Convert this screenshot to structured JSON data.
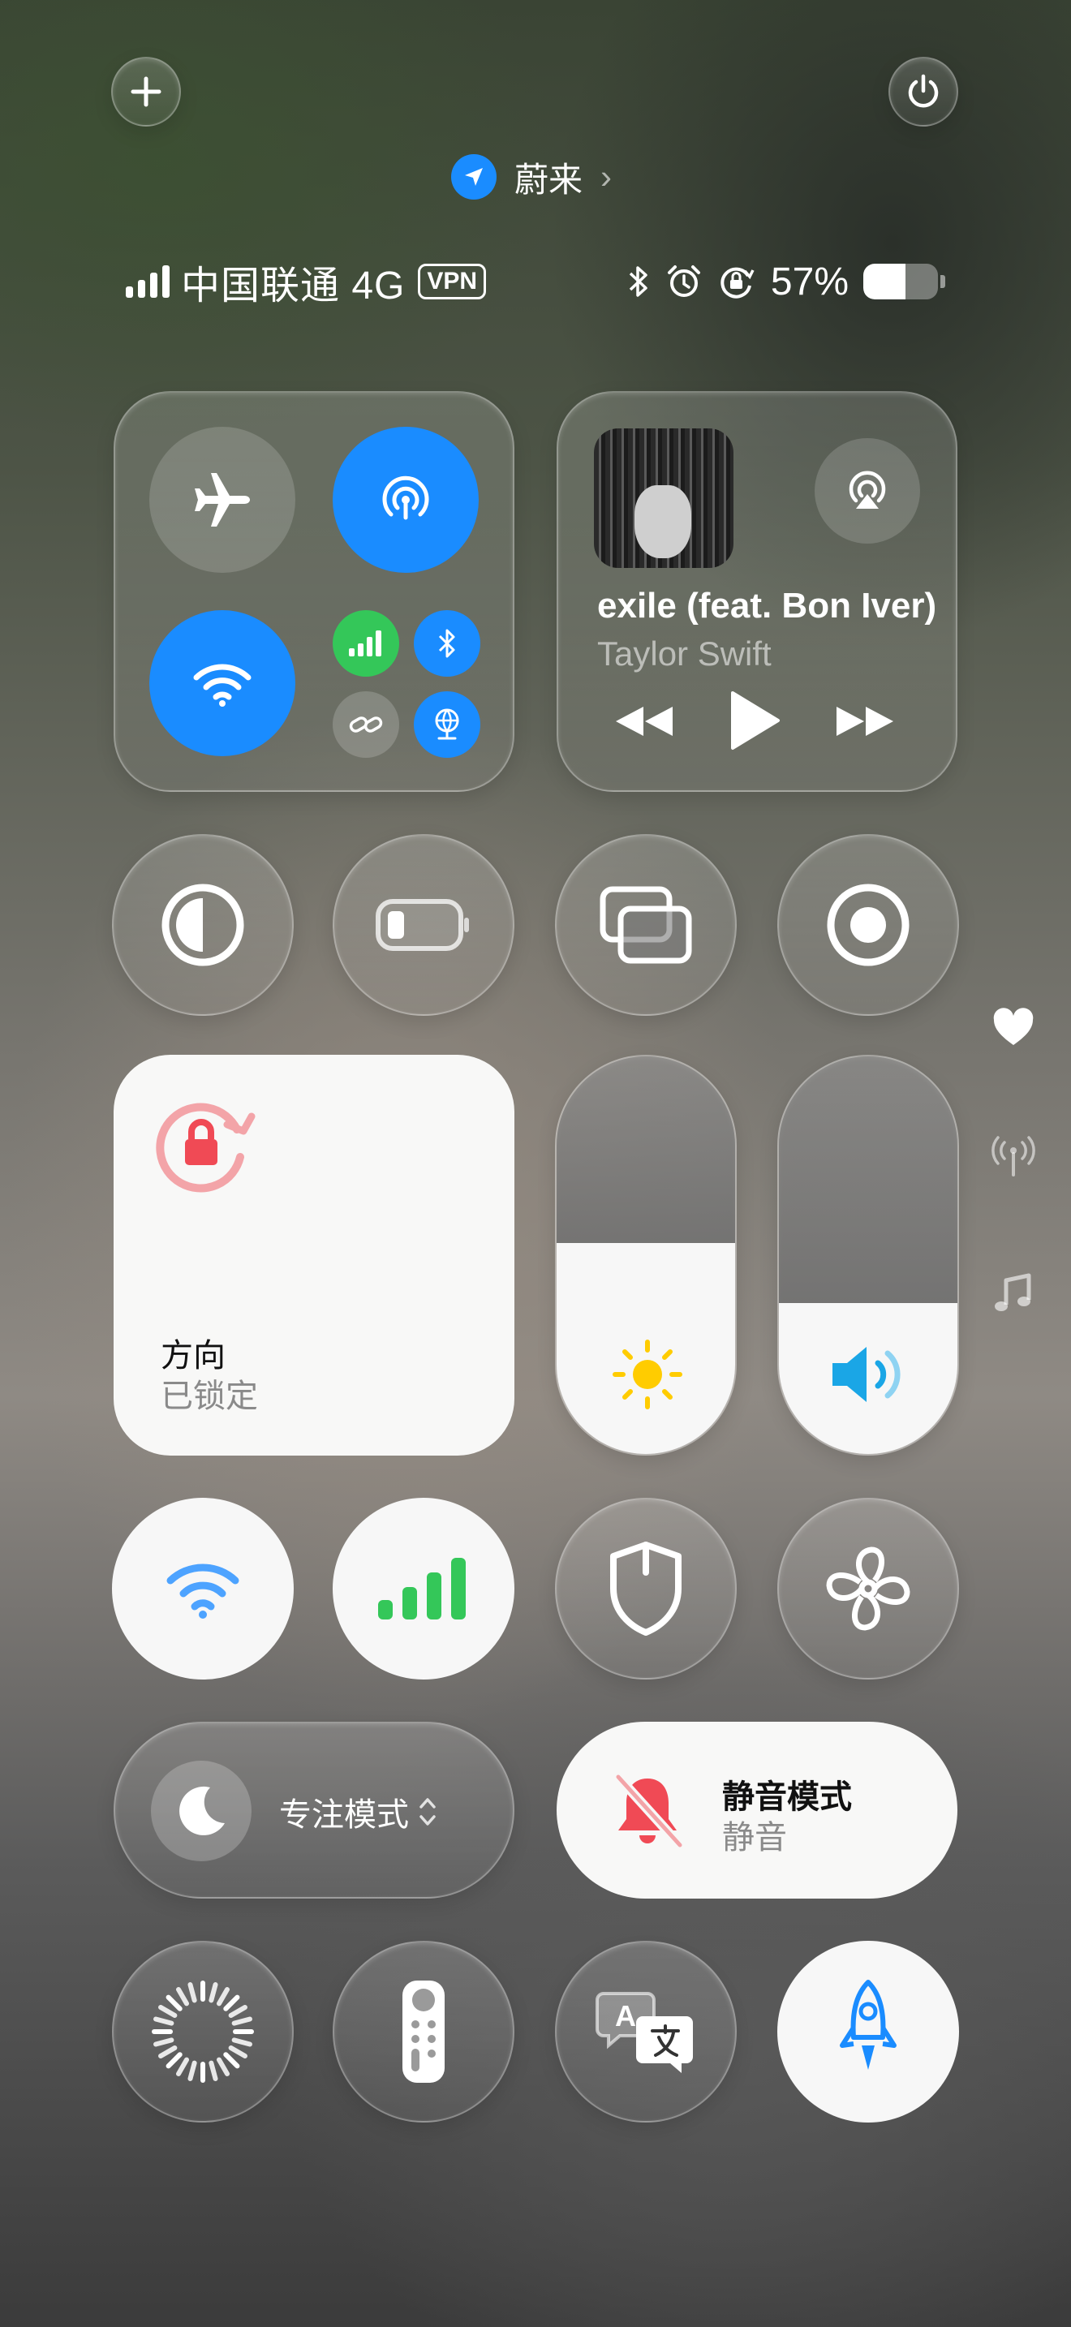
{
  "location": {
    "name": "蔚来"
  },
  "status_bar": {
    "carrier": "中国联通 4G",
    "vpn_label": "VPN",
    "battery_percent_text": "57%",
    "battery_level": 0.57,
    "signal_bars": 4,
    "icons": [
      "bluetooth-icon",
      "alarm-icon",
      "rotation-lock-icon"
    ]
  },
  "connectivity": {
    "airplane": {
      "on": false,
      "icon": "airplane-icon"
    },
    "airdrop": {
      "on": true,
      "icon": "airdrop-icon"
    },
    "wifi": {
      "on": true,
      "icon": "wifi-icon"
    },
    "cellular": {
      "on": true,
      "icon": "cellular-icon",
      "color": "#34c759"
    },
    "bluetooth": {
      "on": true,
      "icon": "bluetooth-icon"
    },
    "hotspot": {
      "on": false,
      "icon": "personal-hotspot-icon"
    },
    "vpn": {
      "on": true,
      "icon": "vpn-globe-icon"
    }
  },
  "media": {
    "title": "exile (feat. Bon Iver)",
    "artist": "Taylor Swift",
    "icons": [
      "airplay-icon",
      "rewind-icon",
      "play-icon",
      "fast-forward-icon"
    ]
  },
  "toggles_row1": [
    "dark-mode-icon",
    "low-power-icon",
    "screen-mirroring-icon",
    "screen-record-icon"
  ],
  "orientation": {
    "title": "方向",
    "subtitle": "已锁定"
  },
  "brightness": {
    "level": 0.53,
    "icon": "sun-icon"
  },
  "volume": {
    "level": 0.38,
    "icon": "speaker-icon"
  },
  "toggles_row3": [
    "wifi-icon",
    "cellular-icon",
    "shield-icon",
    "fan-icon"
  ],
  "focus": {
    "label": "专注模式"
  },
  "mute": {
    "title": "静音模式",
    "subtitle": "静音"
  },
  "toggles_row5": [
    "activity-loader-icon",
    "apple-tv-remote-icon",
    "translate-icon",
    "rocket-icon"
  ],
  "side_indicators": [
    "heart-icon",
    "signal-antenna-icon",
    "music-note-icon"
  ],
  "colors": {
    "accent_blue": "#1a8cff",
    "cellular_green": "#34c759",
    "alert_red": "#f04a55",
    "sun_yellow": "#ffcc00",
    "speaker_blue": "#1aa6e6"
  }
}
